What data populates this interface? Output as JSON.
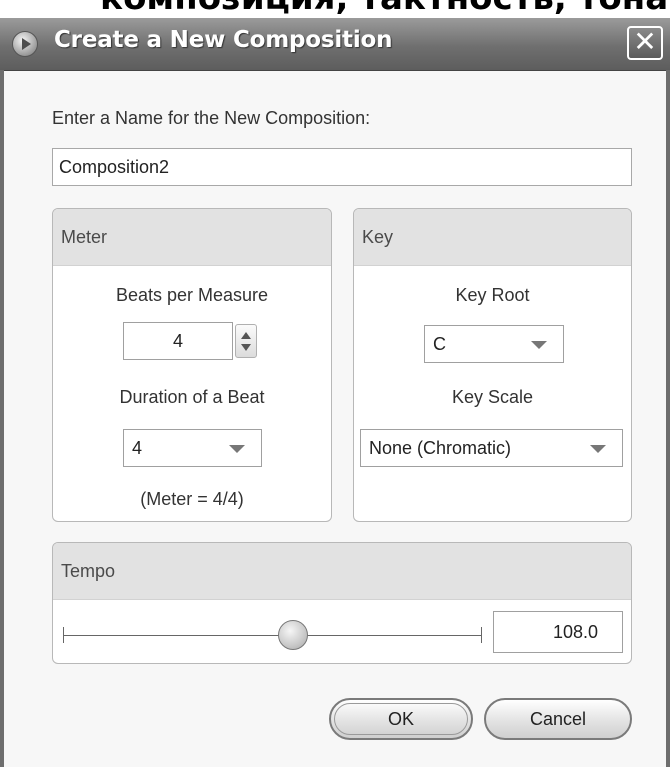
{
  "background_text": "композиция, тактность, тональ",
  "dialog": {
    "title": "Create a New Composition",
    "close_symbol": "✕"
  },
  "name": {
    "prompt": "Enter a Name for the New Composition:",
    "value": "Composition2"
  },
  "meter": {
    "title": "Meter",
    "beats_label": "Beats per Measure",
    "beats_value": "4",
    "duration_label": "Duration of a Beat",
    "duration_value": "4",
    "summary": "(Meter = 4/4)"
  },
  "key": {
    "title": "Key",
    "root_label": "Key Root",
    "root_value": "C",
    "scale_label": "Key Scale",
    "scale_value": "None (Chromatic)"
  },
  "tempo": {
    "title": "Tempo",
    "value": "108.0",
    "slider_fraction": 0.55
  },
  "buttons": {
    "ok": "OK",
    "cancel": "Cancel"
  },
  "icons": {
    "app": "play-circle-icon",
    "close": "close-icon",
    "spinner": "spinner-arrows-icon",
    "dropdown": "chevron-down-icon"
  }
}
